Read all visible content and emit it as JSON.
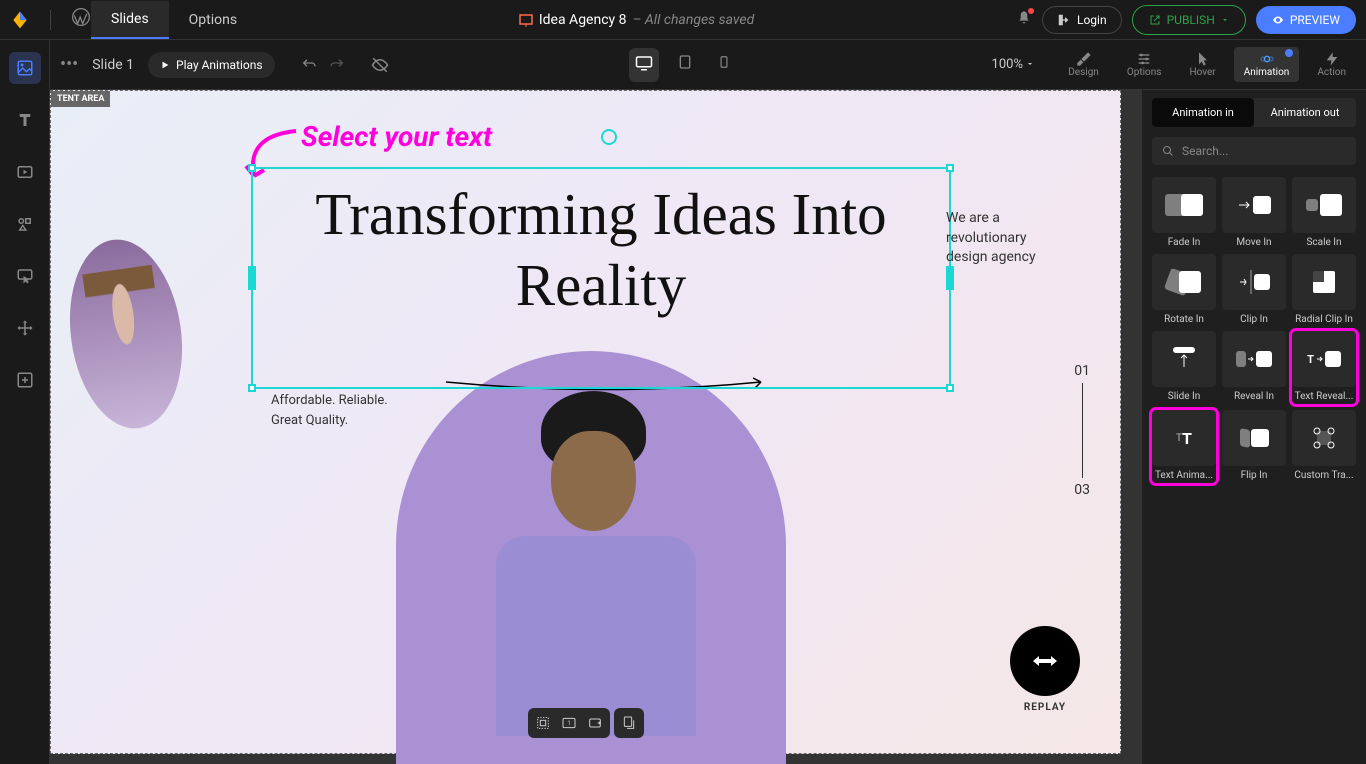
{
  "topbar": {
    "tab_slides": "Slides",
    "tab_options": "Options",
    "doc_title": "Idea Agency 8",
    "saved_text": "– All changes saved",
    "login": "Login",
    "publish": "PUBLISH",
    "preview": "PREVIEW"
  },
  "secondbar": {
    "slide_label": "Slide 1",
    "play_animations": "Play Animations",
    "zoom": "100%"
  },
  "panel_tools": {
    "design": "Design",
    "options": "Options",
    "hover": "Hover",
    "animation": "Animation",
    "action": "Action"
  },
  "canvas": {
    "content_area_tag": "TENT AREA",
    "annotation": "Select your text",
    "headline": "Transforming Ideas Into Reality",
    "subtext_line1": "Affordable. Reliable.",
    "subtext_line2": "Great Quality.",
    "sidetext_line1": "We are a",
    "sidetext_line2": "revolutionary",
    "sidetext_line3": "design agency",
    "page_num1": "01",
    "page_num3": "03",
    "replay": "REPLAY"
  },
  "rightpanel": {
    "tab_in": "Animation in",
    "tab_out": "Animation out",
    "search_placeholder": "Search...",
    "animations": [
      {
        "label": "Fade In"
      },
      {
        "label": "Move In"
      },
      {
        "label": "Scale In"
      },
      {
        "label": "Rotate In"
      },
      {
        "label": "Clip In"
      },
      {
        "label": "Radial Clip In"
      },
      {
        "label": "Slide In"
      },
      {
        "label": "Reveal In"
      },
      {
        "label": "Text Reveal..."
      },
      {
        "label": "Text Anima..."
      },
      {
        "label": "Flip In"
      },
      {
        "label": "Custom Tra..."
      }
    ]
  }
}
